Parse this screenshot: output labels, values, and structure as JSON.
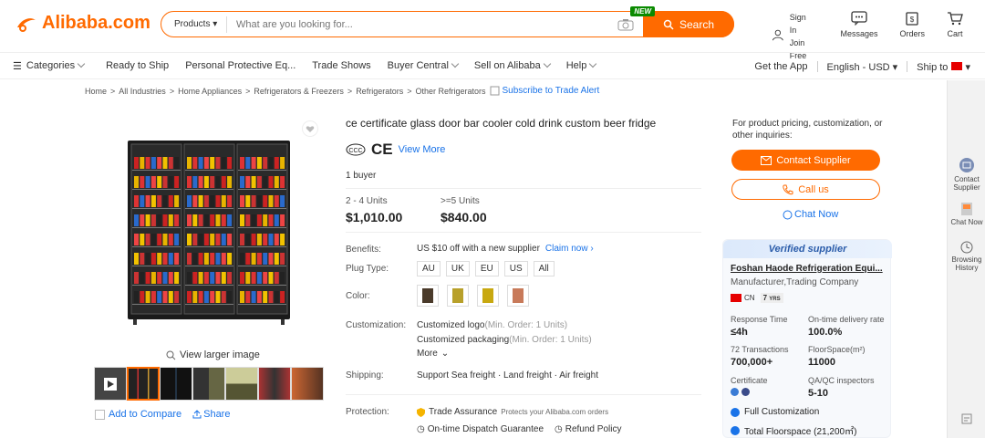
{
  "header": {
    "logo_text": "Alibaba.com",
    "search": {
      "category": "Products",
      "placeholder": "What are you looking for...",
      "button": "Search",
      "new_badge": "NEW"
    },
    "signin": {
      "line1": "Sign In",
      "line2": "Join Free"
    },
    "messages": "Messages",
    "orders": "Orders",
    "cart": "Cart"
  },
  "nav": {
    "categories": "Categories",
    "items": [
      "Ready to Ship",
      "Personal Protective Eq...",
      "Trade Shows",
      "Buyer Central",
      "Sell on Alibaba",
      "Help"
    ],
    "get_app": "Get the App",
    "language": "English - USD",
    "ship_to": "Ship to"
  },
  "breadcrumb": {
    "items": [
      "Home",
      "All Industries",
      "Home Appliances",
      "Refrigerators & Freezers",
      "Refrigerators",
      "Other Refrigerators"
    ],
    "subscribe": "Subscribe to Trade Alert"
  },
  "product": {
    "title": "ce certificate glass door bar cooler cold drink custom beer fridge",
    "view_more": "View More",
    "buyers": "1 buyer",
    "tiers": [
      {
        "range": "2 - 4 Units",
        "price": "$1,010.00"
      },
      {
        "range": ">=5 Units",
        "price": "$840.00"
      }
    ],
    "benefits_label": "Benefits:",
    "benefits_text": "US $10 off with a new supplier",
    "claim": "Claim now",
    "plug_label": "Plug Type:",
    "plugs": [
      "AU",
      "UK",
      "EU",
      "US",
      "All"
    ],
    "color_label": "Color:",
    "custom_label": "Customization:",
    "custom_logo": "Customized logo",
    "custom_logo_min": "(Min. Order: 1 Units)",
    "custom_pack": "Customized packaging",
    "custom_pack_min": "(Min. Order: 1 Units)",
    "more": "More",
    "shipping_label": "Shipping:",
    "shipping_text": "Support Sea freight · Land freight · Air freight",
    "protection_label": "Protection:",
    "trade_assurance": "Trade Assurance",
    "protects": "Protects your Alibaba.com orders",
    "on_time": "On-time Dispatch Guarantee",
    "refund": "Refund Policy"
  },
  "gallery": {
    "view_larger": "View larger image",
    "add_compare": "Add to Compare",
    "share": "Share"
  },
  "contact": {
    "inquiry": "For product pricing, customization, or other inquiries:",
    "contact_supplier": "Contact Supplier",
    "call_us": "Call us",
    "chat_now": "Chat Now"
  },
  "supplier": {
    "verified": "Verified supplier",
    "name": "Foshan Haode Refrigeration Equi...",
    "type": "Manufacturer,Trading Company",
    "country": "CN",
    "years": "7",
    "years_unit": "YRS",
    "metrics": [
      {
        "label": "Response Time",
        "value": "≤4h"
      },
      {
        "label": "On-time delivery rate",
        "value": "100.0%"
      },
      {
        "label": "72 Transactions",
        "value": "700,000+"
      },
      {
        "label": "FloorSpace(m²)",
        "value": "11000"
      },
      {
        "label": "Certificate",
        "value": ""
      },
      {
        "label": "QA/QC inspectors",
        "value": "5-10"
      }
    ],
    "badges": [
      "Full Customization",
      "Total Floorspace (21,200㎡)"
    ]
  },
  "rail": {
    "contact": "Contact Supplier",
    "chat": "Chat Now",
    "history": "Browsing History"
  },
  "colors": {
    "accent": "#ff6a00",
    "link": "#1a73e8"
  }
}
